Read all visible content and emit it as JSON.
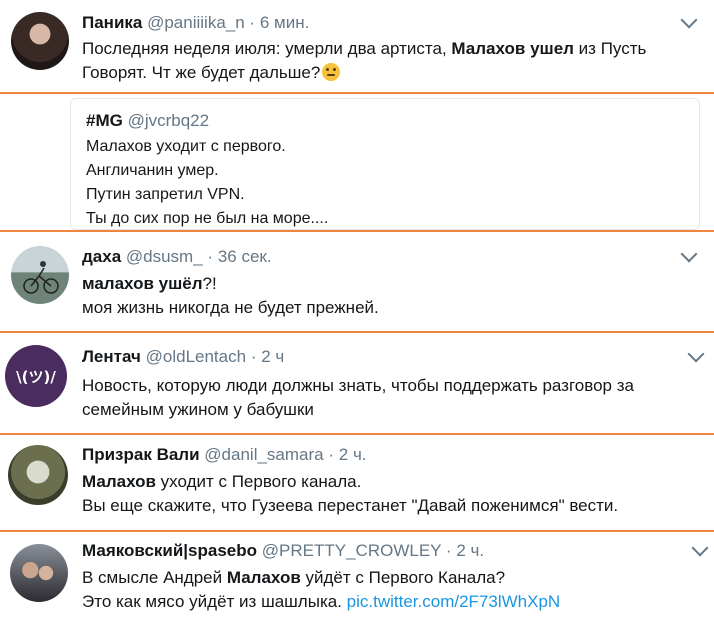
{
  "tweets": [
    {
      "name": "Паника",
      "handle": "@paniiiika_n",
      "dot": "·",
      "time": "6 мин.",
      "line1_pre": "Последняя неделя июля: умерли два артиста, ",
      "line1_bold": "Малахов ушел",
      "line1_post": " из Пусть",
      "line2": "Говорят. Чт же будет дальше?",
      "emoji": "thinking-face-emoji"
    },
    {
      "quote_name": "#MG",
      "quote_handle": "@jvcrbq22",
      "quote_lines": [
        "Малахов уходит с первого.",
        "Англичанин умер.",
        "Путин запретил VPN.",
        "Ты до сих пор не был на море...."
      ]
    },
    {
      "name": "даха",
      "handle": "@dsusm_",
      "dot": "·",
      "time": "36 сек.",
      "line1_bold": "малахов ушёл",
      "line1_post": "?!",
      "line2": "моя жизнь никогда не будет прежней."
    },
    {
      "name": "Лентач",
      "handle": "@oldLentach",
      "dot": "·",
      "time": "2 ч",
      "line1": "Новость, которую люди должны знать, чтобы поддержать разговор за",
      "line2": "семейным ужином у бабушки",
      "avatar_text": "\\(ツ)/"
    },
    {
      "name": "Призрак Вали",
      "handle": "@danil_samara",
      "dot": "·",
      "time": "2 ч.",
      "line1_bold": "Малахов",
      "line1_post": " уходит с Первого канала.",
      "line2": "Вы еще скажите, что Гузеева перестанет \"Давай поженимся\" вести."
    },
    {
      "name": "Маяковский|spasebo",
      "handle": "@PRETTY_CROWLEY",
      "dot": "·",
      "time": "2 ч.",
      "line1_pre": "В смысле Андрей ",
      "line1_bold": "Малахов",
      "line1_post": " уйдёт с Первого Канала?",
      "line2": "Это как мясо уйдёт из шашлыка. ",
      "link": "pic.twitter.com/2F73lWhXpN"
    }
  ],
  "colors": {
    "separator": "#f0843a",
    "link": "#1b95e0",
    "muted": "#657786"
  }
}
